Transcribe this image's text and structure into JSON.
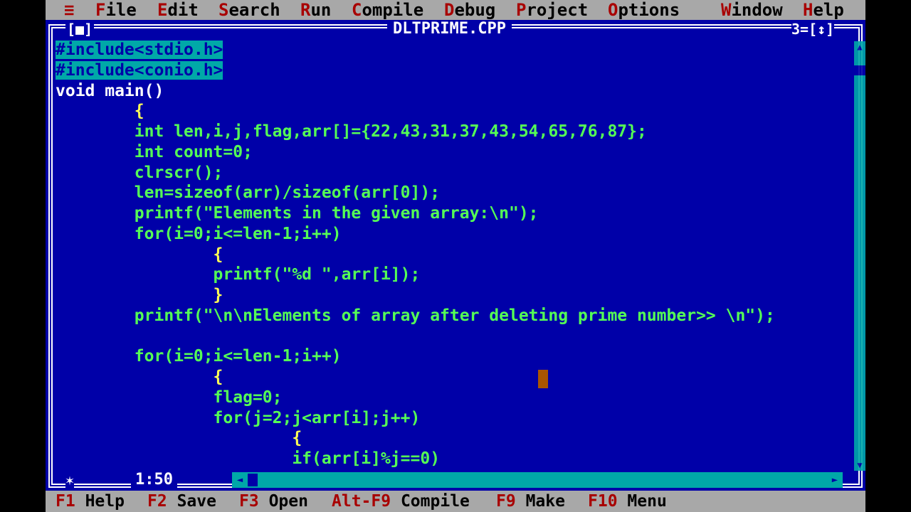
{
  "menu": {
    "system": "≡",
    "items": [
      {
        "hot": "F",
        "rest": "ile"
      },
      {
        "hot": "E",
        "rest": "dit"
      },
      {
        "hot": "S",
        "rest": "earch"
      },
      {
        "hot": "R",
        "rest": "un"
      },
      {
        "hot": "C",
        "rest": "ompile"
      },
      {
        "hot": "D",
        "rest": "ebug"
      },
      {
        "hot": "P",
        "rest": "roject"
      },
      {
        "hot": "O",
        "rest": "ptions"
      },
      {
        "hot": "W",
        "rest": "indow"
      },
      {
        "hot": "H",
        "rest": "elp"
      }
    ]
  },
  "window": {
    "close": "[■]",
    "title": "DLTPRIME.CPP",
    "number": "3=[↕]",
    "position": "1:50"
  },
  "code": [
    "#include<stdio.h>",
    "#include<conio.h>",
    "void main()",
    "        {",
    "        int len,i,j,flag,arr[]={22,43,31,37,43,54,65,76,87};",
    "        int count=0;",
    "        clrscr();",
    "        len=sizeof(arr)/sizeof(arr[0]);",
    "        printf(\"Elements in the given array:\\n\");",
    "        for(i=0;i<=len-1;i++)",
    "                {",
    "                printf(\"%d \",arr[i]);",
    "                }",
    "        printf(\"\\n\\nElements of array after deleting prime number>> \\n\");",
    "",
    "        for(i=0;i<=len-1;i++)",
    "                {",
    "                flag=0;",
    "                for(j=2;j<arr[i];j++)",
    "                        {",
    "                        if(arr[i]%j==0)"
  ],
  "status": [
    {
      "key": "F1",
      "label": "Help"
    },
    {
      "key": "F2",
      "label": "Save"
    },
    {
      "key": "F3",
      "label": "Open"
    },
    {
      "key": "Alt-F9",
      "label": "Compile"
    },
    {
      "key": "F9",
      "label": "Make"
    },
    {
      "key": "F10",
      "label": "Menu"
    }
  ],
  "colors": {
    "background": "#0000a8",
    "menu": "#a8a8a8",
    "hotkey": "#a80000",
    "code": "#55ffff"
  }
}
